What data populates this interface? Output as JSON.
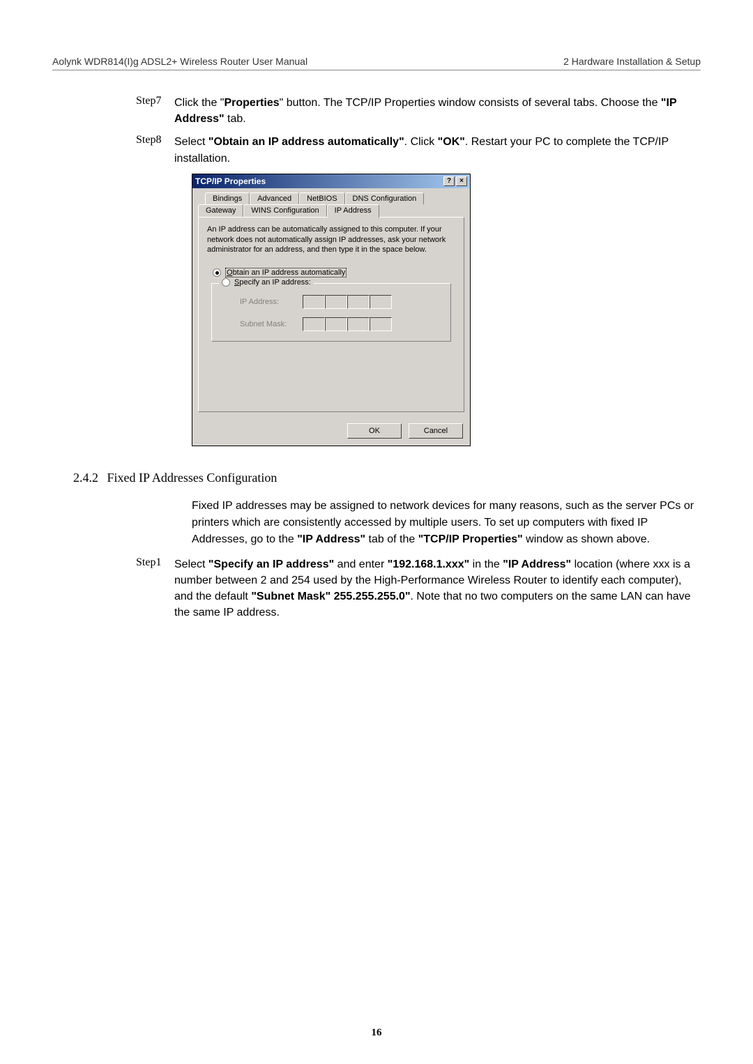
{
  "header": {
    "left": "Aolynk WDR814(I)g ADSL2+ Wireless Router User Manual",
    "right": "2 Hardware Installation & Setup"
  },
  "steps_top": [
    {
      "label": "Step7",
      "parts": [
        {
          "t": "Click the \""
        },
        {
          "t": "Properties",
          "b": true
        },
        {
          "t": "\" button. The TCP/IP Properties window consists of several tabs. Choose the "
        },
        {
          "t": "\"IP Address\"",
          "b": true
        },
        {
          "t": " tab."
        }
      ]
    },
    {
      "label": "Step8",
      "parts": [
        {
          "t": "Select "
        },
        {
          "t": "\"Obtain an IP address automatically\"",
          "b": true
        },
        {
          "t": ". Click "
        },
        {
          "t": "\"OK\"",
          "b": true
        },
        {
          "t": ". Restart your PC to complete the TCP/IP installation."
        }
      ]
    }
  ],
  "dialog": {
    "title": "TCP/IP Properties",
    "help_btn": "?",
    "close_btn": "×",
    "tabs_row1": [
      "Bindings",
      "Advanced",
      "NetBIOS",
      "DNS Configuration"
    ],
    "tabs_row2": [
      "Gateway",
      "WINS Configuration",
      "IP Address"
    ],
    "active_tab": "IP Address",
    "description": "An IP address can be automatically assigned to this computer. If your network does not automatically assign IP addresses, ask your network administrator for an address, and then type it in the space below.",
    "radio_auto": "Obtain an IP address automatically",
    "radio_specify": "Specify an IP address:",
    "ip_label": "IP Address:",
    "mask_label": "Subnet Mask:",
    "ok": "OK",
    "cancel": "Cancel"
  },
  "section": {
    "number": "2.4.2",
    "title": "Fixed IP Addresses Configuration"
  },
  "para1_parts": [
    {
      "t": "Fixed IP addresses may be assigned to network devices for many reasons, such as the server PCs or printers which are consistently accessed by multiple users. To set up computers with fixed IP Addresses, go to the "
    },
    {
      "t": "\"IP Address\"",
      "b": true
    },
    {
      "t": " tab of the "
    },
    {
      "t": "\"TCP/IP Properties\"",
      "b": true
    },
    {
      "t": " window as shown above."
    }
  ],
  "step1": {
    "label": "Step1",
    "parts": [
      {
        "t": "Select "
      },
      {
        "t": "\"Specify an IP address\"",
        "b": true
      },
      {
        "t": " and enter "
      },
      {
        "t": "\"192.168.1.xxx\"",
        "b": true
      },
      {
        "t": " in the "
      },
      {
        "t": "\"IP Address\"",
        "b": true
      },
      {
        "t": " location (where xxx is a number between 2 and 254 used by the High-Performance Wireless Router to identify each computer), and the default "
      },
      {
        "t": "\"Subnet Mask\" 255.255.255.0\"",
        "b": true
      },
      {
        "t": ". Note that no two computers on the same LAN can have the same IP address."
      }
    ]
  },
  "page_number": "16"
}
